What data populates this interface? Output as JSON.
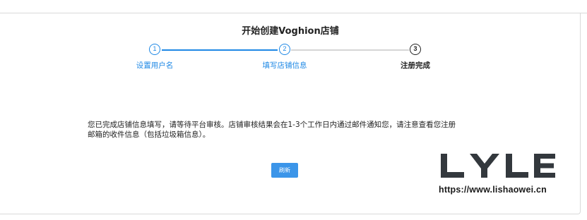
{
  "page": {
    "title": "开始创建Voghion店铺"
  },
  "steps": [
    {
      "number": "1",
      "label": "设置用户名",
      "state": "done"
    },
    {
      "number": "2",
      "label": "填写店铺信息",
      "state": "done"
    },
    {
      "number": "3",
      "label": "注册完成",
      "state": "current"
    }
  ],
  "notice": {
    "line1": "您已完成店铺信息填写，请等待平台审核。店铺审核结果会在1-3个工作日内通过邮件通知您，请注意查看您注册",
    "line2": "邮箱的收件信息（包括垃圾箱信息）。"
  },
  "actions": {
    "refresh_label": "刷新"
  },
  "watermark": {
    "logo_text": "LYLE",
    "url": "https://www.lishaowei.cn"
  },
  "colors": {
    "accent": "#1e88e5",
    "button": "#3b95e9",
    "inactive_line": "#d6d6d6",
    "current_step": "#222222"
  }
}
